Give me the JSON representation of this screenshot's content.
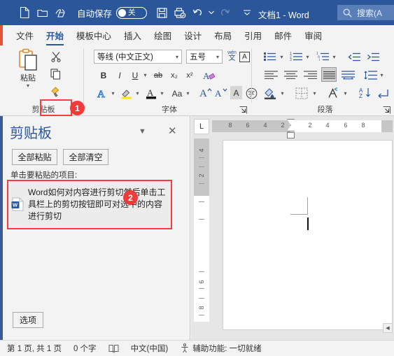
{
  "titlebar": {
    "qat": [
      {
        "name": "new-document-icon",
        "label": "新建"
      },
      {
        "name": "open-folder-icon",
        "label": "打开"
      },
      {
        "name": "touch-mode-icon",
        "label": "触摸/鼠标模式"
      },
      {
        "name": "save-icon",
        "label": "保存"
      },
      {
        "name": "print-preview-icon",
        "label": "打印预览和打印"
      },
      {
        "name": "undo-icon",
        "label": "撤消"
      },
      {
        "name": "redo-icon",
        "label": "恢复"
      },
      {
        "name": "customize-qat-icon",
        "label": "自定义快速访问工具栏"
      }
    ],
    "autosave_label": "自动保存",
    "autosave_state": "关",
    "document_title": "文档1  -  Word",
    "search_placeholder": "搜索(A"
  },
  "tabs": [
    {
      "label": "文件",
      "active": false
    },
    {
      "label": "开始",
      "active": true
    },
    {
      "label": "模板中心",
      "active": false
    },
    {
      "label": "插入",
      "active": false
    },
    {
      "label": "绘图",
      "active": false
    },
    {
      "label": "设计",
      "active": false
    },
    {
      "label": "布局",
      "active": false
    },
    {
      "label": "引用",
      "active": false
    },
    {
      "label": "邮件",
      "active": false
    },
    {
      "label": "审阅",
      "active": false
    }
  ],
  "ribbon": {
    "clipboard": {
      "group_label": "剪贴板",
      "paste_label": "粘贴",
      "cut_label": "剪切",
      "copy_label": "复制",
      "format_painter_label": "格式刷",
      "launcher_label": "剪贴板对话框启动器"
    },
    "font": {
      "group_label": "字体",
      "font_name": "等线 (中文正文)",
      "font_size": "五号",
      "bold": "B",
      "italic": "I",
      "underline": "U",
      "strikethrough": "ab",
      "subscript": "x₂",
      "superscript": "x²",
      "clear_format": "清除所有格式",
      "text_effects": "A",
      "highlight": "文本突出显示颜色",
      "font_color": "字体颜色",
      "change_case": "Aa",
      "grow_font": "增大字号",
      "shrink_font": "减小字号",
      "phonetic_guide": "拼音指南",
      "char_border": "字符边框",
      "launcher_label": "字体对话框启动器"
    },
    "paragraph": {
      "group_label": "段落",
      "bullets": "项目符号",
      "numbering": "编号",
      "multilevel": "多级列表",
      "decrease_indent": "减少缩进量",
      "increase_indent": "增加缩进量",
      "align_left": "左对齐",
      "align_center": "居中",
      "align_right": "右对齐",
      "justify": "两端对齐",
      "distribute": "分散对齐",
      "line_spacing": "行和段落间距",
      "shading": "底纹",
      "borders": "边框",
      "show_marks": "显示/隐藏编辑标记",
      "sort": "排序",
      "launcher_label": "段落对话框启动器"
    }
  },
  "clipboard_pane": {
    "title": "剪贴板",
    "paste_all": "全部粘贴",
    "clear_all": "全部清空",
    "hint": "单击要粘贴的项目:",
    "item_text": "Word如何对内容进行剪切然后单击工具栏上的剪切按钮即可对选中的内容进行剪切",
    "item_icon": "word-document-icon",
    "options": "选项",
    "close_icon": "close-icon",
    "menu_icon": "chevron-down-icon"
  },
  "annotations": [
    {
      "number": "1",
      "target": "clipboard-dialog-launcher"
    },
    {
      "number": "2",
      "target": "clipboard-item"
    }
  ],
  "document": {
    "tab_selector": "L",
    "h_ruler_numbers": [
      "8",
      "6",
      "4",
      "2",
      "2",
      "4",
      "6",
      "8"
    ],
    "v_ruler_numbers": [
      "4",
      "2",
      "6",
      "8"
    ]
  },
  "statusbar": {
    "page_info": "第 1 页, 共 1 页",
    "word_count": "0 个字",
    "proofing_icon": "proofing-icon",
    "language": "中文(中国)",
    "accessibility_icon": "accessibility-icon",
    "accessibility": "辅助功能: 一切就绪"
  },
  "colors": {
    "titlebar": "#2b579a",
    "accent": "#2b579a",
    "annotation_red": "#f33a3a",
    "ribbon_bg": "#f3f3f3"
  }
}
